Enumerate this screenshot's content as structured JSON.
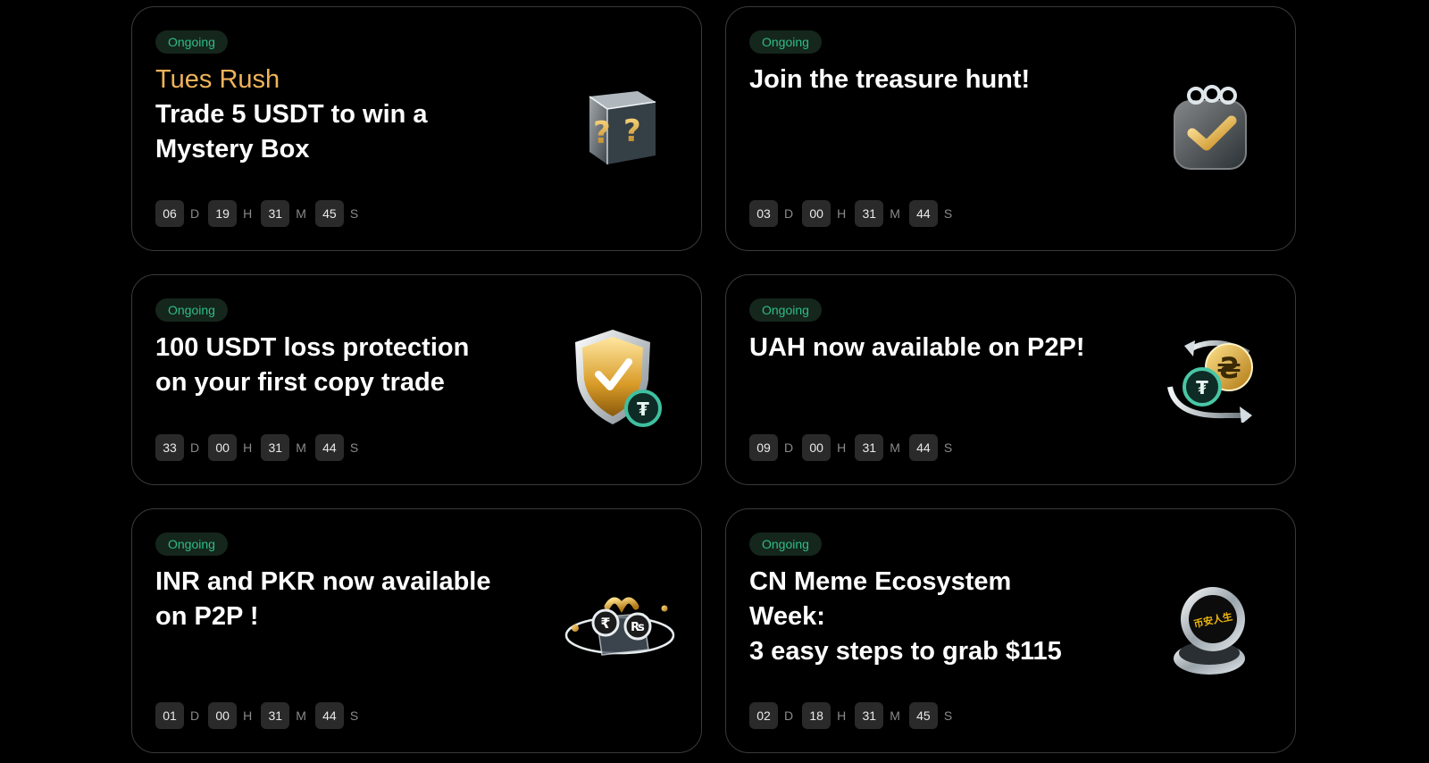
{
  "status_label": "Ongoing",
  "colors": {
    "background": "#000000",
    "card_border": "#3a3a3a",
    "badge_bg": "#15261d",
    "badge_text": "#2ebd85",
    "accent": "#f0b35a",
    "countdown_box": "#2a2a2a"
  },
  "units": {
    "d": "D",
    "h": "H",
    "m": "M",
    "s": "S"
  },
  "cards": [
    {
      "accent": "Tues Rush",
      "title_lines": [
        "Trade 5 USDT to win a",
        "Mystery Box"
      ],
      "icon": "mystery-box-icon",
      "countdown": {
        "d": "06",
        "h": "19",
        "m": "31",
        "s": "45"
      }
    },
    {
      "title_lines": [
        "Join the treasure hunt!"
      ],
      "icon": "calendar-check-icon",
      "countdown": {
        "d": "03",
        "h": "00",
        "m": "31",
        "s": "44"
      }
    },
    {
      "title_lines": [
        "100 USDT loss protection",
        "on your first copy trade"
      ],
      "icon": "shield-check-icon",
      "countdown": {
        "d": "33",
        "h": "00",
        "m": "31",
        "s": "44"
      }
    },
    {
      "title_lines": [
        "UAH now available on P2P!"
      ],
      "icon": "currency-exchange-icon",
      "countdown": {
        "d": "09",
        "h": "00",
        "m": "31",
        "s": "44"
      }
    },
    {
      "title_lines": [
        "INR and PKR now available",
        "on P2P !"
      ],
      "icon": "rupee-coins-icon",
      "countdown": {
        "d": "01",
        "h": "00",
        "m": "31",
        "s": "44"
      }
    },
    {
      "title_lines": [
        "CN Meme Ecosystem",
        "Week:",
        "3 easy steps to grab $115"
      ],
      "icon": "meme-coin-icon",
      "icon_text": "币安人生",
      "countdown": {
        "d": "02",
        "h": "18",
        "m": "31",
        "s": "45"
      }
    }
  ]
}
